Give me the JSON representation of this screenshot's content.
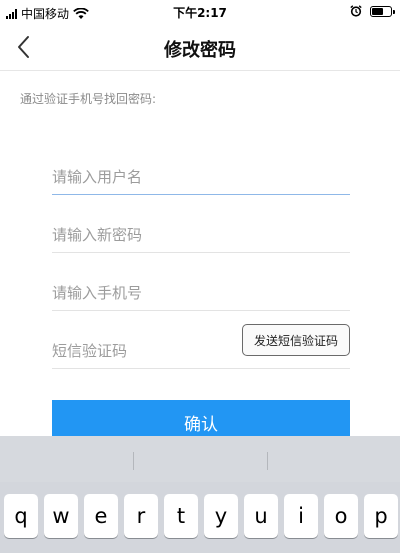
{
  "status_bar": {
    "carrier": "中国移动",
    "time": "下午2:17",
    "battery_level": 0.7
  },
  "navbar": {
    "title": "修改密码",
    "back_icon": "chevron-left-icon"
  },
  "hint": "通过验证手机号找回密码:",
  "form": {
    "username_placeholder": "请输入用户名",
    "new_password_placeholder": "请输入新密码",
    "phone_placeholder": "请输入手机号",
    "code_placeholder": "短信验证码",
    "send_code_label": "发送短信验证码",
    "confirm_label": "确认"
  },
  "keyboard": {
    "keys": [
      "q",
      "w",
      "e",
      "r",
      "t",
      "y",
      "u",
      "i",
      "o",
      "p"
    ]
  },
  "colors": {
    "accent": "#2296f3",
    "active_underline": "#8fb8e8",
    "keyboard_bg": "#d3d6dc"
  }
}
